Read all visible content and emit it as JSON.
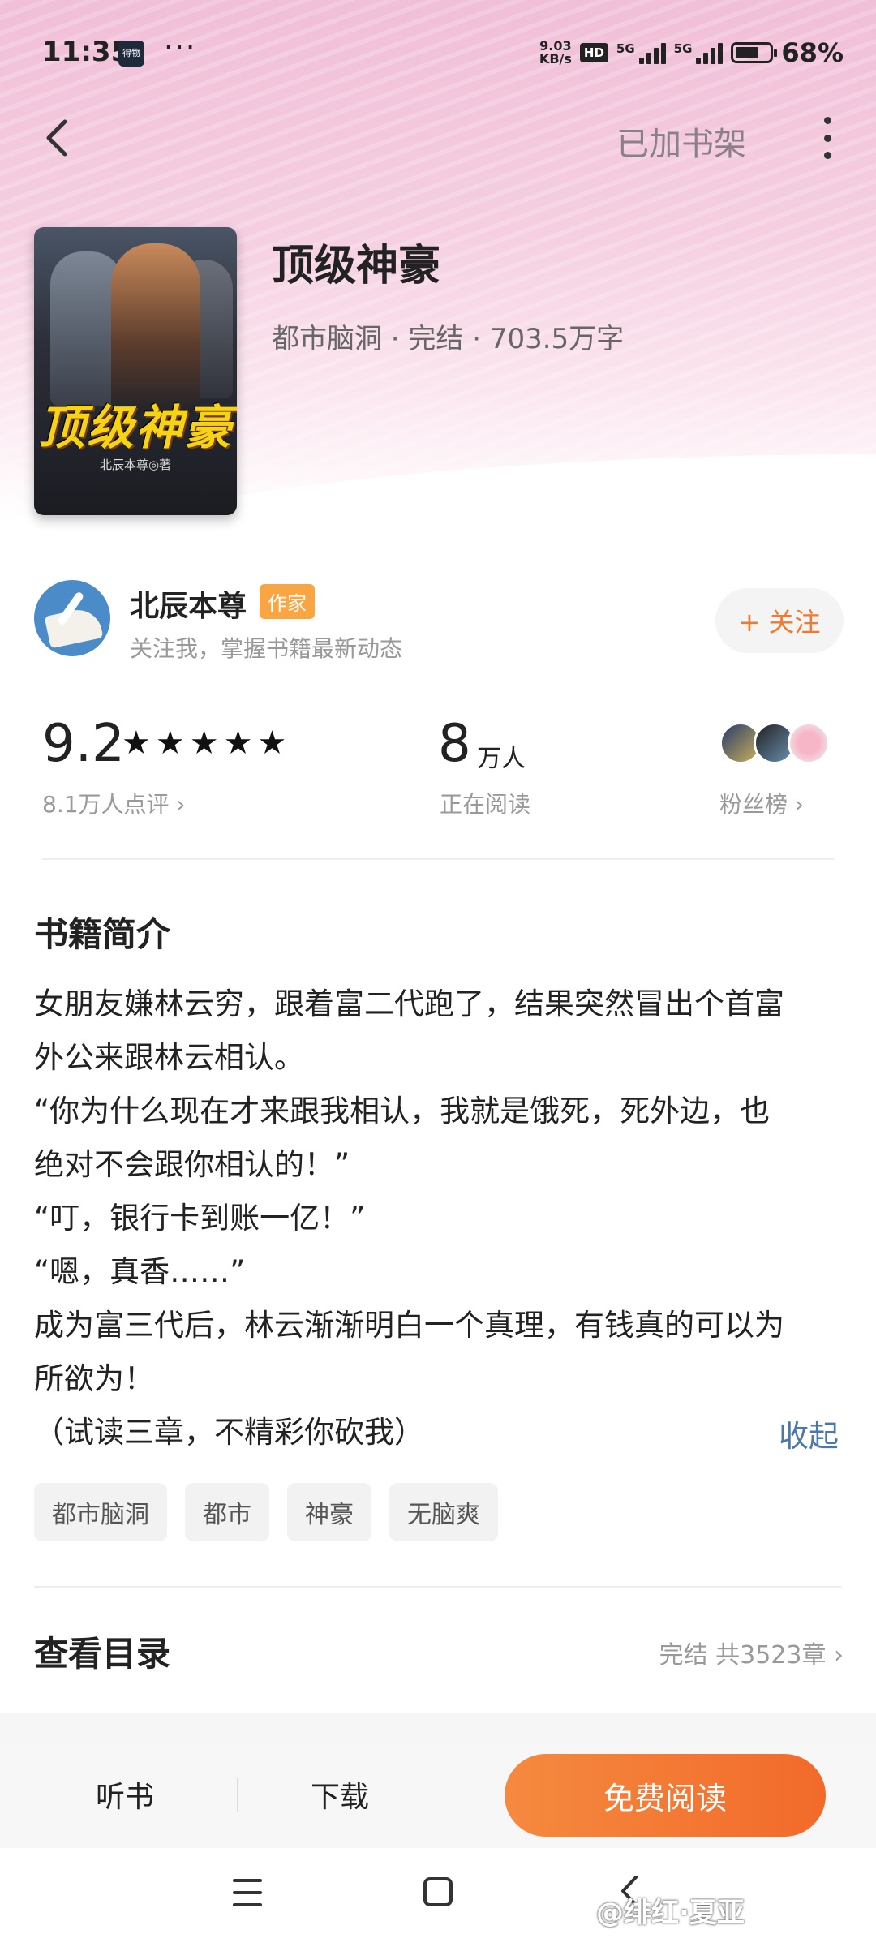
{
  "status_bar": {
    "time": "11:35",
    "app_badge": "得物",
    "more_dots": "···",
    "net_speed_top": "9.03",
    "net_speed_unit": "KB/s",
    "hd_label": "HD",
    "signal1": "5G",
    "signal2": "5G",
    "battery_pct": "68%",
    "battery_level": 0.68
  },
  "nav": {
    "shelf_label": "已加书架"
  },
  "book": {
    "cover_title": "顶级神豪",
    "cover_author": "北辰本尊◎著",
    "title": "顶级神豪",
    "meta": "都市脑洞 · 完结 · 703.5万字"
  },
  "author": {
    "name": "北辰本尊",
    "badge": "作家",
    "subtitle": "关注我，掌握书籍最新动态",
    "follow_label": "+ 关注"
  },
  "stats": {
    "score": "9.2",
    "stars": "★★★★★",
    "reviews": "8.1万人点评 ›",
    "readers_num": "8",
    "readers_unit": "万人",
    "readers_label": "正在阅读",
    "fans_label": "粉丝榜 ›"
  },
  "intro": {
    "heading": "书籍简介",
    "lines": [
      "女朋友嫌林云穷，跟着富二代跑了，结果突然冒出个首富",
      "外公来跟林云相认。",
      "“你为什么现在才来跟我相认，我就是饿死，死外边，也",
      "绝对不会跟你相认的！”",
      "“叮，银行卡到账一亿！”",
      "“嗯，真香……”",
      "成为富三代后，林云渐渐明白一个真理，有钱真的可以为",
      "所欲为！",
      "（试读三章，不精彩你砍我）"
    ],
    "collapse_label": "收起"
  },
  "tags": [
    "都市脑洞",
    "都市",
    "神豪",
    "无脑爽"
  ],
  "toc": {
    "title": "查看目录",
    "info": "完结 共3523章 ›"
  },
  "action_bar": {
    "listen": "听书",
    "download": "下载",
    "read": "免费阅读"
  },
  "watermark": "@绯红·夏亚",
  "colors": {
    "accent": "#f26a2a",
    "link": "#4c78a8",
    "badge": "#f7a643"
  }
}
